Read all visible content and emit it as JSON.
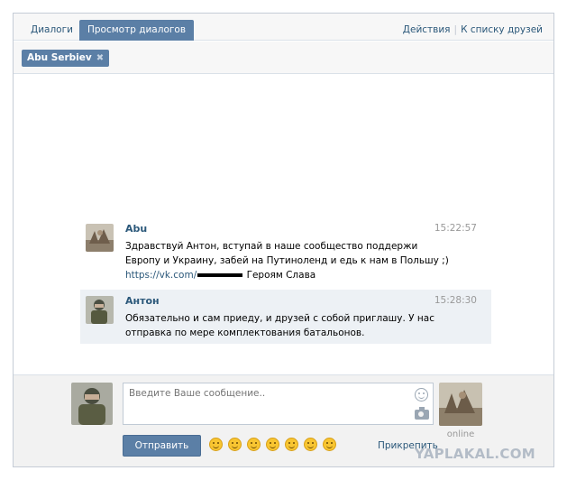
{
  "tabs": [
    {
      "label": "Диалоги"
    },
    {
      "label": "Просмотр диалогов"
    }
  ],
  "actions": {
    "actions_label": "Действия",
    "friends_label": "К списку друзей"
  },
  "chip": {
    "name": "Abu Serbiev"
  },
  "messages": [
    {
      "author": "Abu",
      "time": "15:22:57",
      "text": "Здравствуй Антон, вступай в наше сообщество поддержи Европу и Украину, забей на Путиноленд и едь к нам в Польшу ;)",
      "link_prefix": "https://vk.com/",
      "link_tail": " Героям Слава"
    },
    {
      "author": "Антон",
      "time": "15:28:30",
      "text": "Обязательно и сам приеду, и друзей с собой приглашу. У нас отправка по мере комплектования батальонов."
    }
  ],
  "composer": {
    "placeholder": "Введите Ваше сообщение..",
    "send_label": "Отправить",
    "attach_label": "Прикрепить",
    "online_label": "online"
  },
  "watermark": "YAPLAKAL.COM",
  "colors": {
    "accent": "#5b7fa6",
    "link": "#2b587a",
    "highlight": "#edf1f5"
  }
}
